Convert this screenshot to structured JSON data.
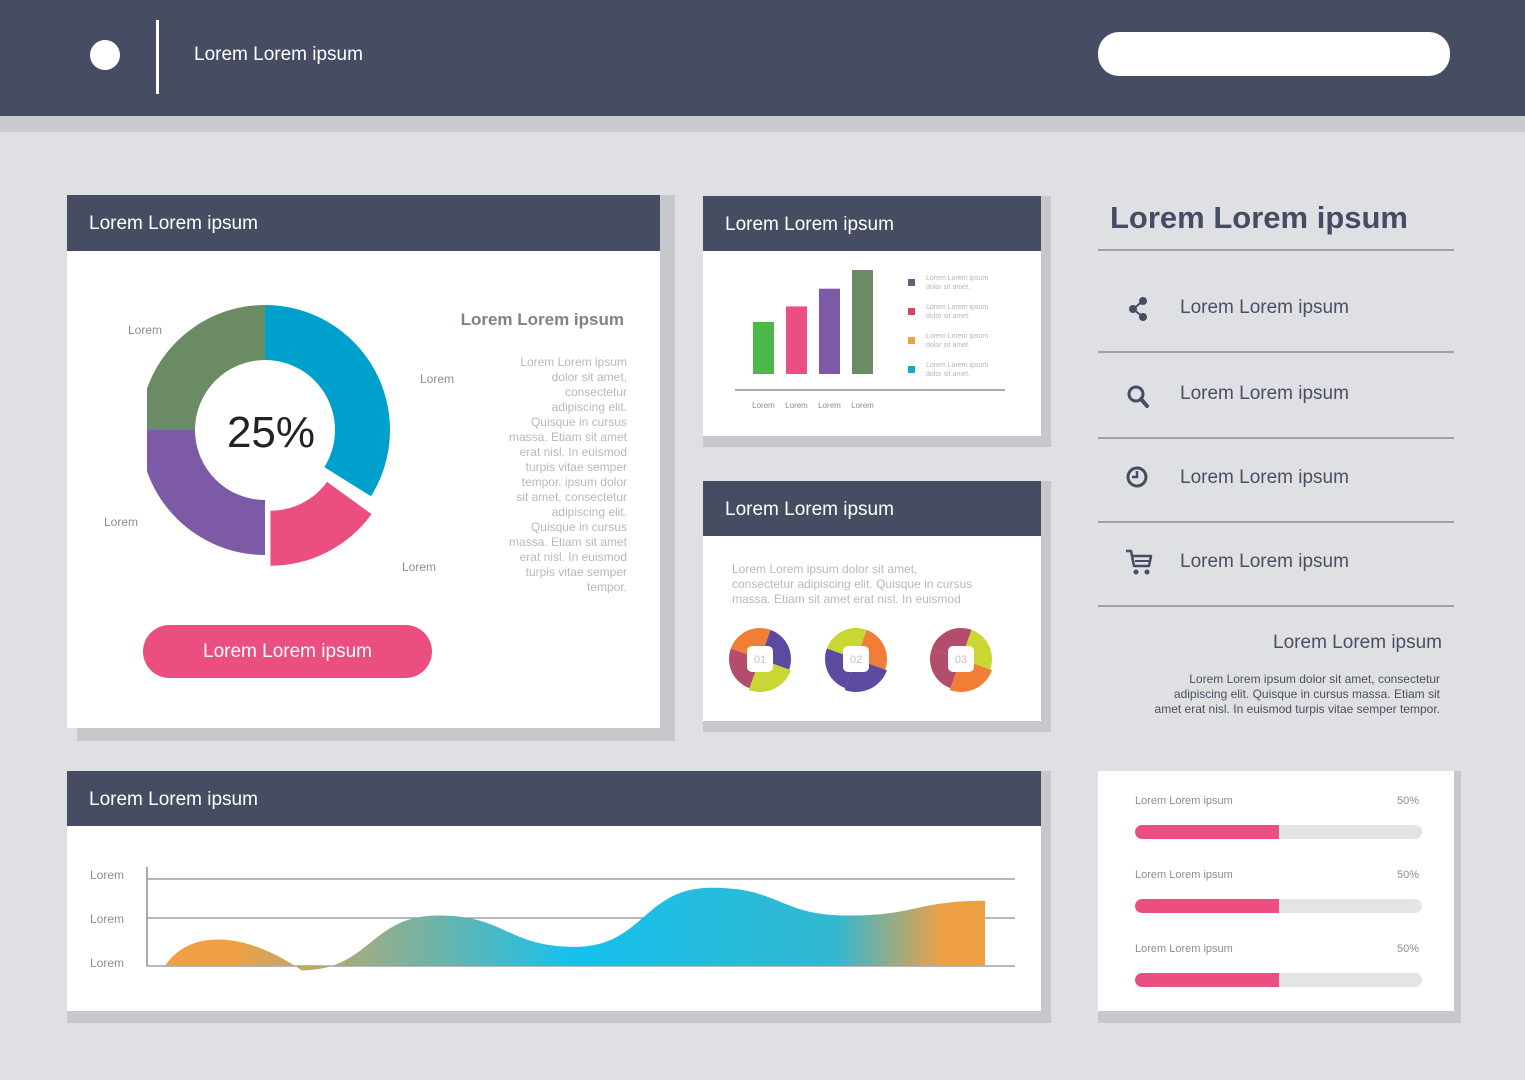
{
  "header": {
    "title": "Lorem Lorem ipsum",
    "search_value": ""
  },
  "donut_card": {
    "title": "Lorem Lorem ipsum",
    "center_value": "25%",
    "labels": [
      "Lorem",
      "Lorem",
      "Lorem",
      "Lorem"
    ],
    "side_title": "Lorem Lorem ipsum",
    "side_text": [
      "Lorem Lorem ipsum",
      "dolor sit amet,",
      "consectetur",
      "adipiscing elit.",
      "Quisque in cursus",
      "massa. Etiam sit amet",
      "erat nisl. In euismod",
      "turpis vitae semper",
      "tempor. ipsum dolor",
      "sit amet, consectetur",
      "adipiscing elit.",
      "Quisque in cursus",
      "massa. Etiam sit amet",
      "erat nisl. In euismod",
      "turpis vitae semper",
      "tempor."
    ],
    "button_label": "Lorem Lorem ipsum",
    "colors": [
      "#00a0cc",
      "#ea4f7f",
      "#7d5aa6",
      "#6a8b63"
    ]
  },
  "bar_card": {
    "title": "Lorem Lorem ipsum",
    "legend": [
      {
        "text": "Lorem Lorem ipsum dolor sit amet.",
        "color": "#5c6478"
      },
      {
        "text": "Lorem Lorem ipsum dolor sit amet.",
        "color": "#d9455f"
      },
      {
        "text": "Lorem Lorem ipsum dolor sit amet.",
        "color": "#f0a044"
      },
      {
        "text": "Lorem Lorem ipsum dolor sit amet.",
        "color": "#1aa7c7"
      }
    ]
  },
  "steps_card": {
    "title": "Lorem Lorem ipsum",
    "text": [
      "Lorem Lorem ipsum dolor sit amet,",
      "consectetur adipiscing elit. Quisque in cursus",
      "massa. Etiam sit amet erat nisl. In euismod"
    ],
    "steps": [
      "01",
      "02",
      "03"
    ]
  },
  "side_panel": {
    "title": "Lorem Lorem ipsum",
    "items": [
      {
        "icon": "share-icon",
        "label": "Lorem Lorem ipsum"
      },
      {
        "icon": "search-icon",
        "label": "Lorem Lorem ipsum"
      },
      {
        "icon": "clock-icon",
        "label": "Lorem Lorem ipsum"
      },
      {
        "icon": "cart-icon",
        "label": "Lorem Lorem ipsum"
      }
    ],
    "sub_title": "Lorem Lorem ipsum",
    "sub_text": [
      "Lorem Lorem ipsum dolor sit amet, consectetur",
      "adipiscing elit. Quisque in cursus massa. Etiam sit",
      "amet erat nisl. In euismod turpis vitae semper tempor."
    ]
  },
  "progress_card": {
    "items": [
      {
        "label": "Lorem Lorem ipsum",
        "pct_text": "50%",
        "value": 0.5
      },
      {
        "label": "Lorem Lorem ipsum",
        "pct_text": "50%",
        "value": 0.5
      },
      {
        "label": "Lorem Lorem ipsum",
        "pct_text": "50%",
        "value": 0.5
      }
    ]
  },
  "area_card": {
    "title": "Lorem Lorem ipsum",
    "y_labels": [
      "Lorem",
      "Lorem",
      "Lorem"
    ]
  },
  "chart_data": [
    {
      "type": "pie",
      "title": "",
      "center_label": "25%",
      "slices": [
        {
          "label": "Lorem",
          "value": 35,
          "color": "#00a0cc"
        },
        {
          "label": "Lorem",
          "value": 15,
          "color": "#ea4f7f"
        },
        {
          "label": "Lorem",
          "value": 25,
          "color": "#7d5aa6"
        },
        {
          "label": "Lorem",
          "value": 25,
          "color": "#6a8b63"
        }
      ]
    },
    {
      "type": "bar",
      "title": "",
      "categories": [
        "Lorem",
        "Lorem",
        "Lorem",
        "Lorem"
      ],
      "values": [
        50,
        65,
        82,
        100
      ],
      "colors": [
        "#4cb848",
        "#ea4f7f",
        "#7d5aa6",
        "#6a8b63"
      ],
      "ylim": [
        0,
        100
      ]
    },
    {
      "type": "area",
      "title": "",
      "y_tick_labels": [
        "Lorem",
        "Lorem",
        "Lorem"
      ],
      "values": [
        30,
        18,
        58,
        22,
        90,
        58,
        75
      ],
      "ylim": [
        0,
        100
      ],
      "gradient": [
        "#f0a044",
        "#15c1ee",
        "#f0a044"
      ]
    }
  ]
}
